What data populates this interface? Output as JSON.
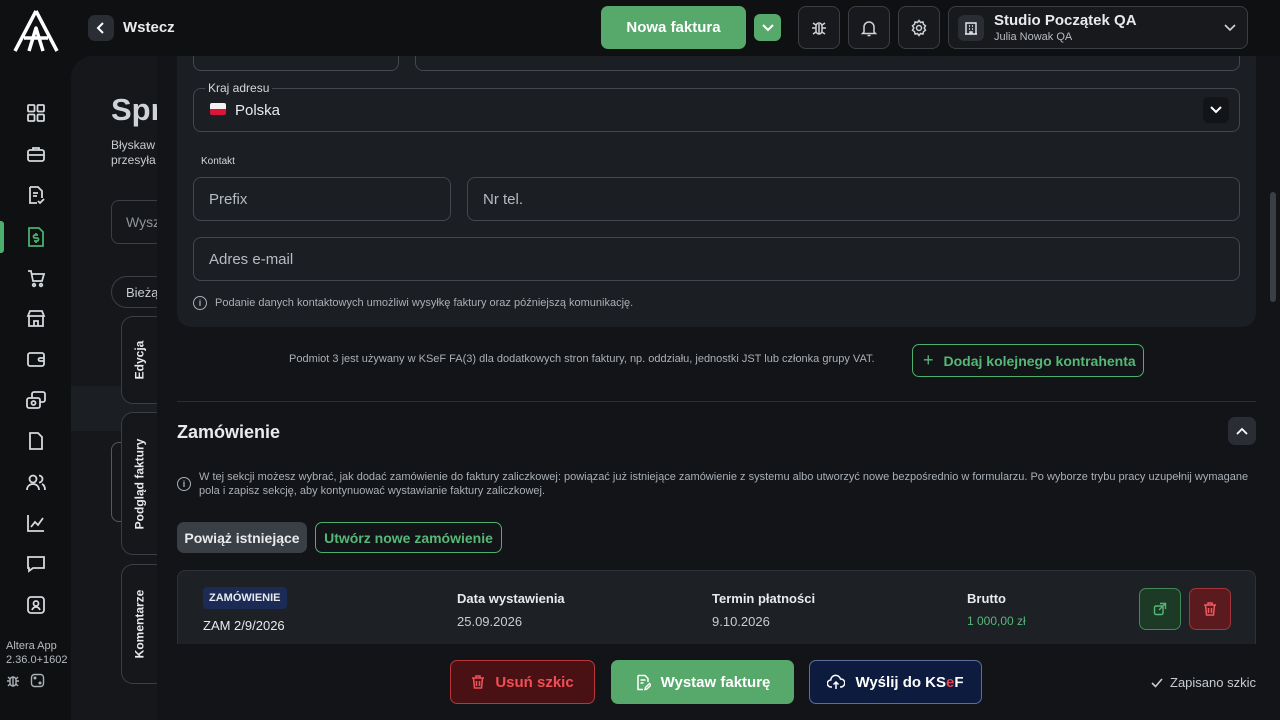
{
  "app": {
    "version_name": "Altera App",
    "version_number": "2.36.0+1602"
  },
  "sidebar": {
    "items": [
      "dashboard-icon",
      "briefcase-icon",
      "document-check-icon",
      "invoice-dollar-icon",
      "cart-icon",
      "store-icon",
      "wallet-icon",
      "transfer-icon",
      "file-icon",
      "users-icon",
      "chart-icon",
      "chat-icon",
      "user-badge-icon"
    ],
    "active": "invoice-dollar-icon"
  },
  "topbar": {
    "back_label": "Wstecz",
    "new_invoice": "Nowa faktura",
    "org_name": "Studio Początek QA",
    "org_user": "Julia Nowak QA"
  },
  "background": {
    "title": "Spr",
    "subtitle_line1": "Błyskaw",
    "subtitle_line2": "przesyła",
    "search": "Wysz",
    "pill": "Bieżą"
  },
  "side_tabs": {
    "edit": "Edycja",
    "preview": "Podgląd faktury",
    "comments": "Komentarze"
  },
  "form": {
    "country_label": "Kraj adresu",
    "country_value": "Polska",
    "contact_label": "Kontakt",
    "prefix_placeholder": "Prefix",
    "phone_placeholder": "Nr tel.",
    "email_placeholder": "Adres e-mail",
    "contact_note": "Podanie danych kontaktowych umożliwi wysyłkę faktury oraz późniejszą komunikację.",
    "entity_note": "Podmiot 3 jest używany w KSeF FA(3) dla dodatkowych stron faktury, np. oddziału, jednostki JST lub członka grupy VAT.",
    "add_contractor": "Dodaj kolejnego kontrahenta"
  },
  "order_section": {
    "title": "Zamówienie",
    "info": "W tej sekcji możesz wybrać, jak dodać zamówienie do faktury zaliczkowej: powiązać już istniejące zamówienie z systemu albo utworzyć nowe bezpośrednio w formularzu. Po wyborze trybu pracy uzupełnij wymagane pola i zapisz sekcję, aby kontynuować wystawianie faktury zaliczkowej.",
    "tab_link": "Powiąż istniejące",
    "tab_create": "Utwórz nowe zamówienie",
    "order": {
      "badge": "ZAMÓWIENIE",
      "number": "ZAM 2/9/2026",
      "issue_label": "Data wystawienia",
      "issue_value": "25.09.2026",
      "due_label": "Termin płatności",
      "due_value": "9.10.2026",
      "gross_label": "Brutto",
      "gross_value": "1 000,00 zł"
    }
  },
  "footer": {
    "delete_draft": "Usuń szkic",
    "issue_invoice": "Wystaw fakturę",
    "send_prefix": "Wyślij do KS",
    "send_e": "e",
    "send_f": "F",
    "saved": "Zapisano szkic"
  },
  "colors": {
    "accent": "#56a86b",
    "danger": "#e0484e",
    "navy": "#0d1b3f"
  }
}
